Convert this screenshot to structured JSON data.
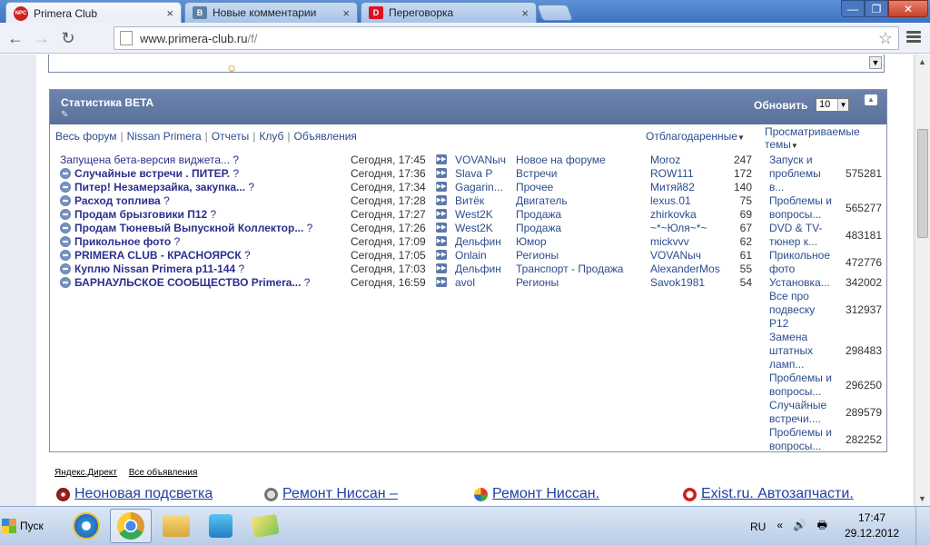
{
  "browser": {
    "tabs": [
      {
        "title": "Primera Club",
        "favicon": "primera-favicon",
        "active": true
      },
      {
        "title": "Новые комментарии",
        "favicon": "vk-favicon",
        "active": false
      },
      {
        "title": "Переговорка",
        "favicon": "d-favicon",
        "active": false
      }
    ],
    "tab_close": "×",
    "window_controls": {
      "minimize": "—",
      "restore": "❐",
      "close": "✕"
    },
    "nav": {
      "back": "←",
      "forward": "→",
      "reload": "↻"
    },
    "url_host": "www.primera-club.ru",
    "url_path": "/f/",
    "star": "☆"
  },
  "widget": {
    "title": "Статистика BETA",
    "pin": "✎",
    "refresh_label": "Обновить",
    "refresh_count": "10",
    "collapse": "▲",
    "nav": [
      "Весь форум",
      "Nissan Primera",
      "Отчеты",
      "Клуб",
      "Объявления"
    ],
    "thanked_header": "Отблагодаренные",
    "viewed_header_1": "Просматриваемые",
    "viewed_header_2": "темы",
    "topics": [
      {
        "title": "Запущена бета-версия виджета...",
        "bold": false,
        "icon": false,
        "time": "Сегодня, 17:45",
        "author": "VOVANыч",
        "category": "Новое на форуме"
      },
      {
        "title": "Случайные встречи . ПИТЕР.",
        "bold": true,
        "icon": true,
        "time": "Сегодня, 17:36",
        "author": "Slava P",
        "category": "Встречи"
      },
      {
        "title": "Питер! Незамерзайка, закупка...",
        "bold": true,
        "icon": true,
        "time": "Сегодня, 17:34",
        "author": "Gagarin...",
        "category": "Прочее"
      },
      {
        "title": "Расход топлива",
        "bold": true,
        "icon": true,
        "time": "Сегодня, 17:28",
        "author": "Витёк",
        "category": "Двигатель"
      },
      {
        "title": "Продам брызговики П12",
        "bold": true,
        "icon": true,
        "time": "Сегодня, 17:27",
        "author": "West2K",
        "category": "Продажа"
      },
      {
        "title": "Продам Тюневый Выпускной Коллектор...",
        "bold": true,
        "icon": true,
        "time": "Сегодня, 17:26",
        "author": "West2K",
        "category": "Продажа"
      },
      {
        "title": "Прикольное фото",
        "bold": true,
        "icon": true,
        "time": "Сегодня, 17:09",
        "author": "Дельфин",
        "category": "Юмор"
      },
      {
        "title": "PRIMERA CLUB - КРАСНОЯРСК",
        "bold": true,
        "icon": true,
        "time": "Сегодня, 17:05",
        "author": "Onlain",
        "category": "Регионы"
      },
      {
        "title": "Куплю Nissan Primera p11-144",
        "bold": true,
        "icon": true,
        "time": "Сегодня, 17:03",
        "author": "Дельфин",
        "category": "Транспорт - Продажа"
      },
      {
        "title": "БАРНАУЛЬСКОЕ СООБЩЕСТВО Primera...",
        "bold": true,
        "icon": true,
        "time": "Сегодня, 16:59",
        "author": "avol",
        "category": "Регионы"
      }
    ],
    "thanked": [
      {
        "user": "Moroz",
        "count": "247"
      },
      {
        "user": "ROW111",
        "count": "172"
      },
      {
        "user": "Митяй82",
        "count": "140"
      },
      {
        "user": "lexus.01",
        "count": "75"
      },
      {
        "user": "zhirkovka",
        "count": "69"
      },
      {
        "user": "~*~Юля~*~",
        "count": "67"
      },
      {
        "user": "mickvvv",
        "count": "62"
      },
      {
        "user": "VOVANыч",
        "count": "61"
      },
      {
        "user": "AlexanderMos",
        "count": "55"
      },
      {
        "user": "Savok1981",
        "count": "54"
      }
    ],
    "viewed": [
      {
        "lines": [
          "Запуск и",
          "проблемы",
          "в..."
        ],
        "count": "575281"
      },
      {
        "lines": [
          "Проблемы и",
          "вопросы..."
        ],
        "count": "565277"
      },
      {
        "lines": [
          "DVD & TV-",
          "тюнер к..."
        ],
        "count": "483181"
      },
      {
        "lines": [
          "Прикольное",
          "фото"
        ],
        "count": "472776"
      },
      {
        "lines": [
          "Установка..."
        ],
        "count": "342002"
      },
      {
        "lines": [
          "Все про",
          "подвеску",
          "P12"
        ],
        "count": "312937"
      },
      {
        "lines": [
          "Замена",
          "штатных",
          "ламп..."
        ],
        "count": "298483"
      },
      {
        "lines": [
          "Проблемы и",
          "вопросы..."
        ],
        "count": "296250"
      },
      {
        "lines": [
          "Случайные",
          "встречи...."
        ],
        "count": "289579"
      },
      {
        "lines": [
          "Проблемы и",
          "вопросы..."
        ],
        "count": "282252"
      }
    ]
  },
  "ads": {
    "link1": "Яндекс.Директ",
    "link2": "Все объявления",
    "items": [
      {
        "text": "Неоновая подсветка",
        "icon": "neon-icon"
      },
      {
        "text": "Ремонт Ниссан –",
        "icon": "nissan-icon"
      },
      {
        "text": "Ремонт Ниссан.",
        "icon": "colorful-icon"
      },
      {
        "text": "Exist.ru. Автозапчасти.",
        "icon": "exist-icon"
      }
    ]
  },
  "taskbar": {
    "start": "Пуск",
    "lang": "RU",
    "tray_icons": "« 🔊 🖶",
    "time": "17:47",
    "date": "29.12.2012"
  }
}
